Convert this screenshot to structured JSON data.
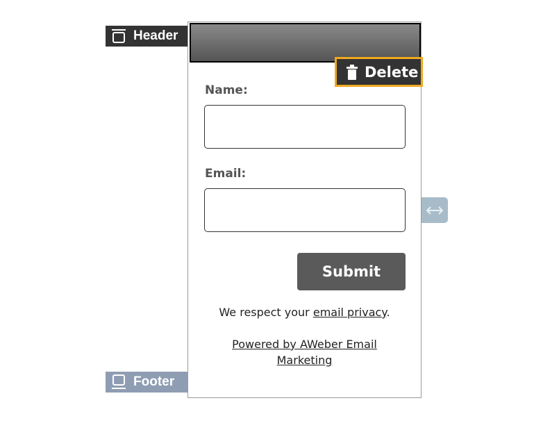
{
  "header_tag": {
    "label": "Header",
    "icon": "header-layout-icon"
  },
  "footer_tag": {
    "label": "Footer",
    "icon": "footer-layout-icon"
  },
  "delete_button": {
    "label": "Delete",
    "icon": "trash-icon"
  },
  "form": {
    "name_label": "Name:",
    "name_value": "",
    "email_label": "Email:",
    "email_value": "",
    "submit_label": "Submit",
    "privacy_prefix": "We respect your ",
    "privacy_link": "email privacy",
    "privacy_suffix": ".",
    "powered_link": "Powered by AWeber Email Marketing"
  },
  "resize_handle": {
    "icon": "horizontal-resize-icon"
  },
  "colors": {
    "header_tag_bg": "#333333",
    "footer_tag_bg": "#8f9db3",
    "selection_outline": "#f0a81e",
    "submit_bg": "#5a5a5a",
    "resize_handle_bg": "#a8bbc9"
  }
}
